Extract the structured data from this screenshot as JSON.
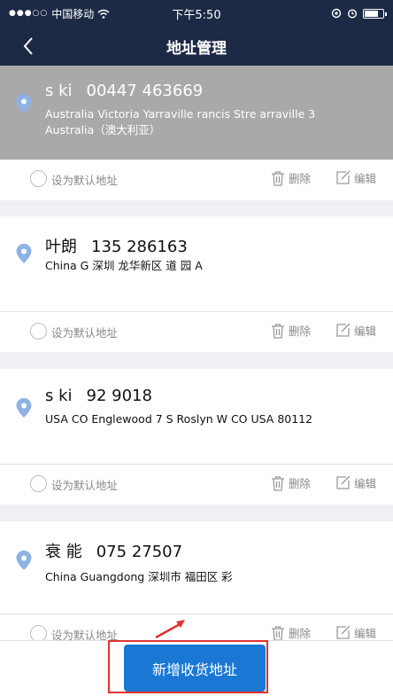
{
  "status_bar": {
    "carrier": "中国移动",
    "time": "下午5:50"
  },
  "nav": {
    "title": "地址管理"
  },
  "actions": {
    "set_default": "设为默认地址",
    "delete": "删除",
    "edit": "编辑"
  },
  "addresses": [
    {
      "name": "s  ki",
      "phone": "00447  463669",
      "address": "Australia Victoria Yarraville  rancis Stre  arraville 3 Australia（澳大利亚）"
    },
    {
      "name": "叶朗",
      "phone": "135  286163",
      "address": "China G 深圳 龙华新区  道  园 A"
    },
    {
      "name": "s  ki",
      "phone": "92  9018",
      "address": "USA CO Englewood 7 S Roslyn W CO USA 80112"
    },
    {
      "name": "衰  能",
      "phone": "075  27507",
      "address": "China Guangdong 深圳市 福田区 彩"
    }
  ],
  "bottom": {
    "add_button": "新增收货地址"
  },
  "colors": {
    "nav_bg": "#1d2a45",
    "accent": "#1a78d4",
    "highlight": "#a9a9a9",
    "annotation": "#e03232"
  }
}
